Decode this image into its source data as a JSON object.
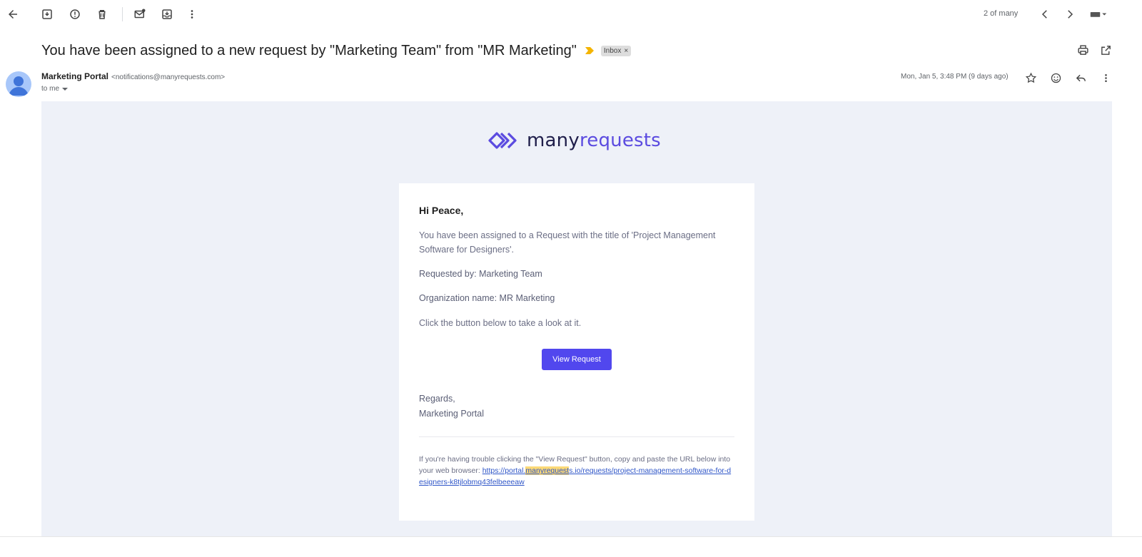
{
  "toolbar": {
    "back": "back-arrow-icon",
    "archive": "archive-icon",
    "spam": "report-spam-icon",
    "delete": "trash-icon",
    "mark_unread": "mark-unread-icon",
    "move": "move-to-inbox-icon",
    "more": "more-vert-icon",
    "pager_text": "2 of many"
  },
  "message": {
    "subject": "You have been assigned to a new request by \"Marketing Team\" from \"MR Marketing\"",
    "label": "Inbox",
    "label_close": "×",
    "sender_name": "Marketing Portal",
    "sender_email": "<notifications@manyrequests.com>",
    "recipient": "to me",
    "date": "Mon, Jan 5, 3:48 PM (9 days ago)"
  },
  "email": {
    "logo_part1": "many",
    "logo_part2": "requests",
    "greeting": "Hi Peace,",
    "p1": "You have been assigned to a Request with the title of 'Project Management Software for Designers'.",
    "p2": "Requested by: Marketing Team",
    "p3": "Organization name: MR Marketing",
    "p4": "Click the button below to take a look at it.",
    "button_label": "View Request",
    "regards": "Regards,",
    "signature": "Marketing Portal",
    "footer_text": "If you're having trouble clicking the \"View Request\" button, copy and paste the URL below into your web browser: ",
    "url_prefix": "https://portal.",
    "url_highlight": "manyrequest",
    "url_rest": "s.io/requests/project-management-software-for-designers-k8tjlobmq43felbeeeaw"
  },
  "colors": {
    "accent": "#5147ee",
    "body_bg": "#eef1f8",
    "link": "#2f56c8",
    "highlight": "#fbd977"
  }
}
